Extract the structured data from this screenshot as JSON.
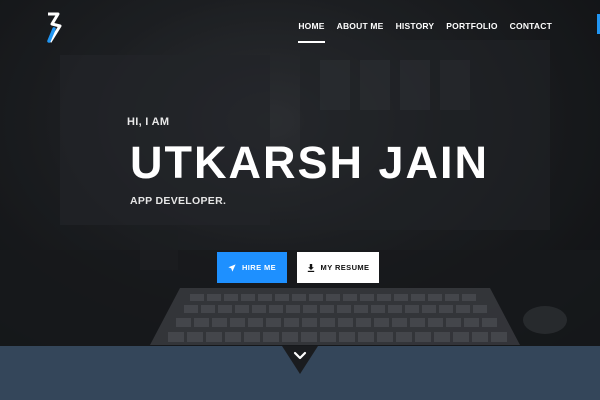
{
  "nav": {
    "items": [
      {
        "label": "HOME",
        "active": true
      },
      {
        "label": "ABOUT ME",
        "active": false
      },
      {
        "label": "HISTORY",
        "active": false
      },
      {
        "label": "PORTFOLIO",
        "active": false
      },
      {
        "label": "CONTACT",
        "active": false
      }
    ]
  },
  "hero": {
    "greeting": "HI, I AM",
    "name": "UTKARSH JAIN",
    "role": "APP DEVELOPER."
  },
  "buttons": {
    "hire": "HIRE ME",
    "resume": "MY RESUME"
  },
  "colors": {
    "accent": "#1e90ff",
    "bottom_bar": "#34465a",
    "logo_blue": "#2196f3"
  },
  "icons": {
    "logo": "s-logo-icon",
    "hire": "paper-plane-icon",
    "resume": "download-icon",
    "scroll": "chevron-down-icon"
  }
}
